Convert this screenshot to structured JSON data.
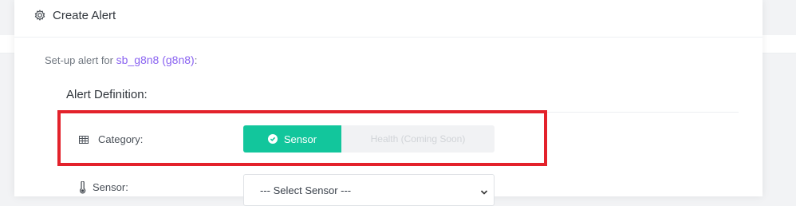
{
  "modal": {
    "title": "Create Alert",
    "header_icon": "gear-icon"
  },
  "setup": {
    "prefix": "Set-up alert for",
    "device": "sb_g8n8 (g8n8)",
    "suffix": ":"
  },
  "alert_definition": {
    "title": "Alert Definition:",
    "category": {
      "icon": "grid-table-icon",
      "label": "Category:",
      "options": [
        {
          "label": "Sensor",
          "selected": true,
          "icon": "check-circle-icon"
        },
        {
          "label": "Health (Coming Soon)",
          "selected": false,
          "disabled": true
        }
      ]
    },
    "sensor": {
      "icon": "thermometer-icon",
      "label": "Sensor:",
      "selected_value": "--- Select Sensor ---",
      "chevron_icon": "chevron-down-icon"
    }
  },
  "colors": {
    "active_toggle": "#12c69c",
    "device_link": "#8a63f1",
    "highlight_box": "#e3222b"
  }
}
